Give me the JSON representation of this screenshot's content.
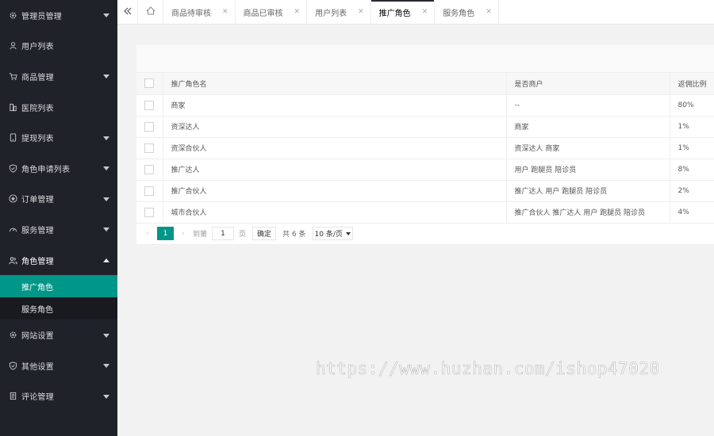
{
  "sidebar": {
    "items": [
      {
        "label": "管理员管理",
        "icon": "gear-icon",
        "has_caret": true
      },
      {
        "label": "用户列表",
        "icon": "user-icon",
        "has_caret": false
      },
      {
        "label": "商品管理",
        "icon": "cart-icon",
        "has_caret": true
      },
      {
        "label": "医院列表",
        "icon": "building-icon",
        "has_caret": false
      },
      {
        "label": "提现列表",
        "icon": "tablet-icon",
        "has_caret": true
      },
      {
        "label": "角色申请列表",
        "icon": "shield-icon",
        "has_caret": true
      },
      {
        "label": "订单管理",
        "icon": "star-icon",
        "has_caret": true
      },
      {
        "label": "服务管理",
        "icon": "gauge-icon",
        "has_caret": true
      },
      {
        "label": "角色管理",
        "icon": "users-icon",
        "has_caret": true,
        "expanded": true,
        "children": [
          {
            "label": "推广角色",
            "active": true
          },
          {
            "label": "服务角色",
            "active": false
          }
        ]
      },
      {
        "label": "网站设置",
        "icon": "gear-icon",
        "has_caret": true
      },
      {
        "label": "其他设置",
        "icon": "shield-icon",
        "has_caret": true
      },
      {
        "label": "评论管理",
        "icon": "doc-icon",
        "has_caret": true
      }
    ]
  },
  "tabs": [
    {
      "label": "商品待审核",
      "active": false
    },
    {
      "label": "商品已审核",
      "active": false
    },
    {
      "label": "用户列表",
      "active": false
    },
    {
      "label": "推广角色",
      "active": true
    },
    {
      "label": "服务角色",
      "active": false
    }
  ],
  "table": {
    "headers": [
      "推广角色名",
      "是否商户",
      "返佣比例"
    ],
    "rows": [
      [
        "商家",
        "--",
        "80%"
      ],
      [
        "资深达人",
        "商家",
        "1%"
      ],
      [
        "资深合伙人",
        "资深达人 商家",
        "1%"
      ],
      [
        "推广达人",
        "用户 跑腿员 陪诊员",
        "8%"
      ],
      [
        "推广合伙人",
        "推广达人 用户 跑腿员 陪诊员",
        "2%"
      ],
      [
        "城市合伙人",
        "推广合伙人 推广达人 用户 跑腿员 陪诊员",
        "4%"
      ]
    ]
  },
  "pager": {
    "current": "1",
    "goto_label": "到第",
    "page_value": "1",
    "page_unit": "页",
    "confirm": "确定",
    "total": "共 6 条",
    "page_size": "10 条/页"
  },
  "watermark": "https://www.huzhan.com/ishop47020",
  "colors": {
    "accent": "#009688",
    "sidebar_bg": "#20222a"
  }
}
